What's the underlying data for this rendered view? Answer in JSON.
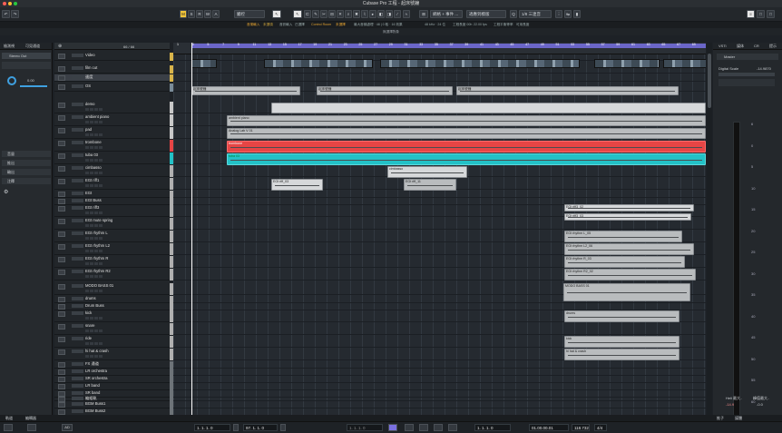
{
  "window": {
    "title": "Cubase Pro 工程 - 起床號鐘"
  },
  "toolbar": {
    "mode_buttons": [
      "M",
      "S",
      "R",
      "W",
      "A"
    ],
    "touch_mode": "觸控",
    "snap_type": "網格 + 事件 ...",
    "snap_label": "適應到模版",
    "quantize": "1/8 三連音",
    "right_buttons": [
      "≡",
      "□",
      "□"
    ]
  },
  "infobar": [
    "音樂輸入",
    "未選項",
    "音訊輸入",
    "已選擇",
    "Control Room",
    "未選擇",
    "最大音頻處理 · 48 | 0 取 · 16 效果",
    "48 kHz · 24 位",
    "工程長度 00h",
    "22.00 fps",
    "工程平衡等率",
    "可用長度"
  ],
  "subbar_text": "無選擇對象",
  "inspector": {
    "tabs": [
      "檢測視",
      "可見通道"
    ],
    "track_title": "Stereo Out",
    "volume": "0.00",
    "sections": [
      "音量",
      "推出",
      "輸出",
      "注釋"
    ]
  },
  "tracklist": {
    "header_count": "66 / 66",
    "tracks": [
      {
        "name": "Video"
      },
      {
        "name": "film cut"
      },
      {
        "name": "速度"
      },
      {
        "name": "OS"
      },
      {
        "name": "demo"
      },
      {
        "name": "ambient piano"
      },
      {
        "name": "pad"
      },
      {
        "name": "trombone"
      },
      {
        "name": "tuba 03"
      },
      {
        "name": "cimbasso"
      },
      {
        "name": "EGt riff1"
      },
      {
        "name": "EGt"
      },
      {
        "name": "EGt Buss"
      },
      {
        "name": "EGt riff3"
      },
      {
        "name": "EGt mute spring"
      },
      {
        "name": "EGt rhythm L"
      },
      {
        "name": "EGt rhythm L2"
      },
      {
        "name": "EGt rhythm R"
      },
      {
        "name": "EGt rhythm R2"
      },
      {
        "name": "MODO BASS 01"
      },
      {
        "name": "drums"
      },
      {
        "name": "Drum Buss"
      },
      {
        "name": "kick"
      },
      {
        "name": "snare"
      },
      {
        "name": "ride"
      },
      {
        "name": "hi hat & crash"
      },
      {
        "name": "FX 通道"
      },
      {
        "name": "LR orchestra"
      },
      {
        "name": "SR orchestra"
      },
      {
        "name": "LR band"
      },
      {
        "name": "SR band"
      },
      {
        "name": "編組軌"
      },
      {
        "name": "BGM Buss1"
      },
      {
        "name": "BGM Buss2"
      }
    ]
  },
  "arrange": {
    "ruler_numbers": [
      "1",
      "3",
      "5",
      "7",
      "9",
      "11",
      "13",
      "15",
      "17",
      "19",
      "21",
      "23",
      "25",
      "27",
      "29",
      "31",
      "33",
      "35",
      "37",
      "39",
      "41",
      "43",
      "45",
      "47",
      "49",
      "51",
      "53",
      "55",
      "57",
      "59",
      "61",
      "63",
      "65",
      "67",
      "69"
    ],
    "clips": [
      {
        "label": "起床號鐘"
      },
      {
        "label": "起床號鐘"
      },
      {
        "label": "起床號鐘"
      },
      {
        "label": "ambient piano"
      },
      {
        "label": "Analog Lab V 01"
      },
      {
        "label": "trombone"
      },
      {
        "label": "tuba 03"
      },
      {
        "label": "cimbasso"
      },
      {
        "label": "EGt riff_03"
      },
      {
        "label": "EGt riff_11"
      },
      {
        "label": "EGt riff3_02"
      },
      {
        "label": "EGt riff3_03"
      },
      {
        "label": "EGt rhythm L_05"
      },
      {
        "label": "EGt rhythm L2_06"
      },
      {
        "label": "EGt rhythm R_03"
      },
      {
        "label": "EGt rhythm R2_02"
      },
      {
        "label": "MODO BASS 01"
      },
      {
        "label": "drums"
      },
      {
        "label": "kick"
      },
      {
        "label": "hi hat & crash"
      }
    ]
  },
  "mixer": {
    "tabs": [
      "VSTi",
      "媒体",
      "CR",
      "提示"
    ],
    "channel": "Master",
    "output_label": "Digital Scale",
    "output_value": "-14.9870",
    "scale": [
      "6",
      "0",
      "5",
      "10",
      "15",
      "20",
      "25",
      "30",
      "35",
      "40",
      "45",
      "50",
      "55",
      "60"
    ],
    "footer_left": "Heli 最大..",
    "footer_left_val": "-14.9",
    "footer_right": "峰值最大..",
    "footer_right_val": "-0.0"
  },
  "transport": {
    "pos_left": "1. 1. 1. 0",
    "pos_mid": "97. 1. 1. 0",
    "pos_right": "1. 1. 1. 0",
    "pos2": "1. 1. 1. 0",
    "time": "01.00.00.01",
    "tempo": "118.732",
    "signature": "4/4"
  },
  "bottom_tabs": [
    "軌道",
    "編輯器",
    "推子",
    "媒體"
  ]
}
